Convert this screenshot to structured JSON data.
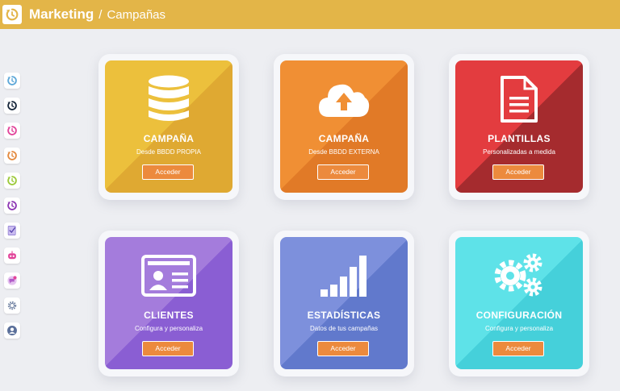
{
  "header": {
    "title": "Marketing",
    "separator": "/",
    "subtitle": "Campañas"
  },
  "colors": {
    "topbar": "#e3b548",
    "button": "#ec8a3d",
    "sidebar_icons": [
      "#5ea8d8",
      "#17263a",
      "#e2449a",
      "#e48a3e",
      "#9cc93a",
      "#8d36b4",
      "#a48ed6",
      "#e2449a",
      "#c476d8",
      "#7a8aa8",
      "#5a6f9a"
    ]
  },
  "sidebar": {
    "icons": [
      "logo-blue-icon",
      "logo-dark-icon",
      "logo-pink-icon",
      "logo-orange-icon",
      "logo-green-icon",
      "logo-purple-icon",
      "checklist-icon",
      "robot-icon",
      "chat-badge-icon",
      "gear-icon",
      "user-icon"
    ]
  },
  "cards": [
    {
      "title": "CAMPAÑA",
      "subtitle": "Desde BBDD PROPIA",
      "button": "Acceder",
      "icon": "database-icon",
      "color_a": "#ecc03c",
      "color_b": "#dfa932"
    },
    {
      "title": "CAMPAÑA",
      "subtitle": "Desde BBDD EXTERNA",
      "button": "Acceder",
      "icon": "cloud-upload-icon",
      "color_a": "#f08f34",
      "color_b": "#e17a27"
    },
    {
      "title": "PLANTILLAS",
      "subtitle": "Personalizadas a medida",
      "button": "Acceder",
      "icon": "document-icon",
      "color_a": "#e33c3f",
      "color_b": "#a52b2e"
    },
    {
      "title": "CLIENTES",
      "subtitle": "Configura y personaliza",
      "button": "Acceder",
      "icon": "id-card-icon",
      "color_a": "#a47cdc",
      "color_b": "#8a5ed3"
    },
    {
      "title": "ESTADÍSTICAS",
      "subtitle": "Datos de tus campañas",
      "button": "Acceder",
      "icon": "signal-bars-icon",
      "color_a": "#7d90dc",
      "color_b": "#6179cc"
    },
    {
      "title": "CONFIGURACIÓN",
      "subtitle": "Configura y personaliza",
      "button": "Acceder",
      "icon": "gears-icon",
      "color_a": "#5ee2e8",
      "color_b": "#45d0da"
    }
  ]
}
